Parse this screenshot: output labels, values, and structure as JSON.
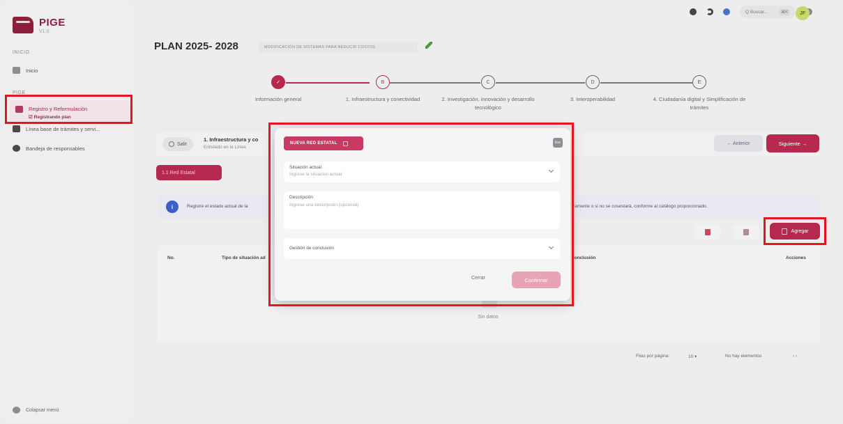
{
  "app": {
    "name": "PIGE",
    "version": "V1.0"
  },
  "sidebar": {
    "section_inicio": "INICIO",
    "item_inicio": "Inicio",
    "section_pige": "PIGE",
    "item_registro": "Registro y Reformulación",
    "item_registro_sub": "☑ Registrando plan",
    "item_linea": "Línea base de trámites y servi...",
    "item_bandeja": "Bandeja de responsables",
    "collapse": "Colapsar menú"
  },
  "topbar": {
    "search_placeholder": "Q Buscar...",
    "search_shortcut": "⌘K",
    "avatar_initials": "JF"
  },
  "header": {
    "title": "PLAN 2025- 2028",
    "chip": "MODIFICACIÓN DE SISTEMAS PARA REDUCIR COSTOS"
  },
  "stepper": [
    {
      "mark": "✓",
      "label": "Información general",
      "state": "done"
    },
    {
      "mark": "B",
      "label": "1. Infraestructura y conectividad",
      "state": "current"
    },
    {
      "mark": "C",
      "label": "2. Investigación, innovación y desarrollo tecnológico",
      "state": "pending"
    },
    {
      "mark": "D",
      "label": "3. Interoperabilidad",
      "state": "pending"
    },
    {
      "mark": "E",
      "label": "4. Ciudadanía digital y Simplificación de trámites",
      "state": "pending"
    }
  ],
  "toolbar": {
    "salir": "Salir",
    "section_title": "1. Infraestructura y co",
    "section_sub": "Enlistado en la Línea",
    "anterior": "← Anterior",
    "siguiente": "Siguiente →"
  },
  "tab_chip": "1.1 Red Estatal",
  "info": {
    "icon": "i",
    "left": "Registre el estado actual de la",
    "right": "ramente o si no se cosestará, conforme al catálogo proporcionado."
  },
  "agregar": "Agregar",
  "table": {
    "headers": [
      "No.",
      "Tipo de situación ad",
      "conclusión",
      "Acciones"
    ],
    "empty": "Sin datos"
  },
  "pager": {
    "rows_label": "Filas por página:",
    "rows_value": "10 ▾",
    "range": "No hay elementos",
    "nav": "‹   ›"
  },
  "modal": {
    "chip": "NUEVA RED ESTATAL",
    "close": "Esc",
    "field1_label": "Situación actual",
    "field1_placeholder": "Ingrese la situación actual",
    "field2_label": "Descripción",
    "field2_placeholder": "Ingrese una descripción (opcional)",
    "field3_label": "Gestión de conclusión",
    "cerrar": "Cerrar",
    "confirmar": "Confirmar"
  },
  "colors": {
    "brand": "#b5294f",
    "highlight": "#e8141f",
    "info": "#3e5fc6"
  }
}
